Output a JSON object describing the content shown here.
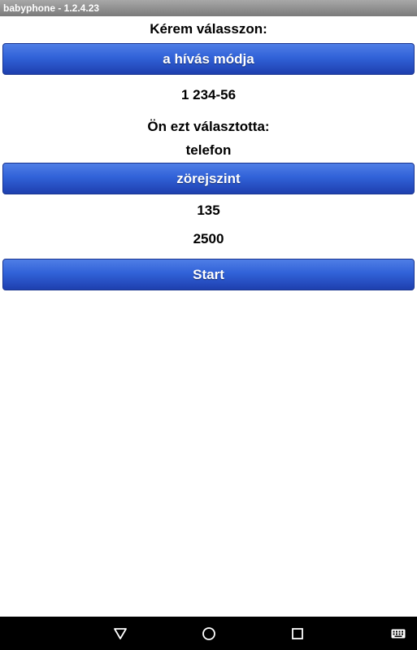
{
  "app": {
    "title": "babyphone - 1.2.4.23"
  },
  "main": {
    "prompt_label": "Kérem válasszon:",
    "call_mode_button": "a hívás módja",
    "number_value": "1 234-56",
    "selected_label": "Ön ezt választotta:",
    "selected_value": "telefon",
    "noise_level_button": "zörejszint",
    "noise_value_1": "135",
    "noise_value_2": "2500",
    "start_button": "Start"
  },
  "navbar": {
    "icons": [
      "back-icon",
      "home-icon",
      "recents-icon",
      "keyboard-icon"
    ],
    "color": "#000000"
  },
  "colors": {
    "button_accent": "#3162d8",
    "titlebar": "#8a8a8a"
  }
}
